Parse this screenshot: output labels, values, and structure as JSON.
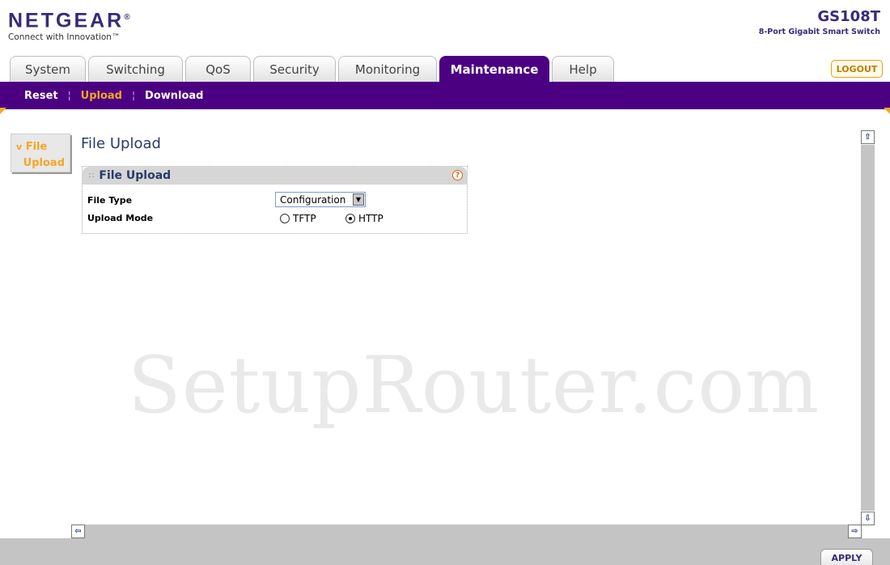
{
  "header": {
    "logo": "NETGEAR",
    "logo_mark": "®",
    "tagline": "Connect with Innovation™",
    "model": "GS108T",
    "model_desc": "8-Port Gigabit Smart Switch"
  },
  "tabs": [
    {
      "label": "System",
      "active": false
    },
    {
      "label": "Switching",
      "active": false
    },
    {
      "label": "QoS",
      "active": false
    },
    {
      "label": "Security",
      "active": false
    },
    {
      "label": "Monitoring",
      "active": false
    },
    {
      "label": "Maintenance",
      "active": true
    },
    {
      "label": "Help",
      "active": false
    }
  ],
  "logout_label": "LOGOUT",
  "subnav": [
    {
      "label": "Reset",
      "active": false
    },
    {
      "label": "Upload",
      "active": true
    },
    {
      "label": "Download",
      "active": false
    }
  ],
  "leftnav": {
    "arrow": "v",
    "line1": "File",
    "line2": "Upload"
  },
  "page_title": "File Upload",
  "panel": {
    "title": "File Upload",
    "help_glyph": "?",
    "file_type_label": "File Type",
    "file_type_value": "Configuration",
    "upload_mode_label": "Upload Mode",
    "modes": [
      {
        "label": "TFTP",
        "checked": false
      },
      {
        "label": "HTTP",
        "checked": true
      }
    ]
  },
  "watermark": "SetupRouter.com",
  "apply_label": "APPLY",
  "colors": {
    "brand_purple": "#4b0082",
    "accent_orange": "#f5a623",
    "title_blue": "#2a3a6a"
  },
  "icons": {
    "scroll_up": "arrow-up-icon",
    "scroll_down": "arrow-down-icon",
    "scroll_left": "arrow-left-icon",
    "scroll_right": "arrow-right-icon",
    "help": "help-icon",
    "select_arrow": "chevron-down-icon"
  }
}
